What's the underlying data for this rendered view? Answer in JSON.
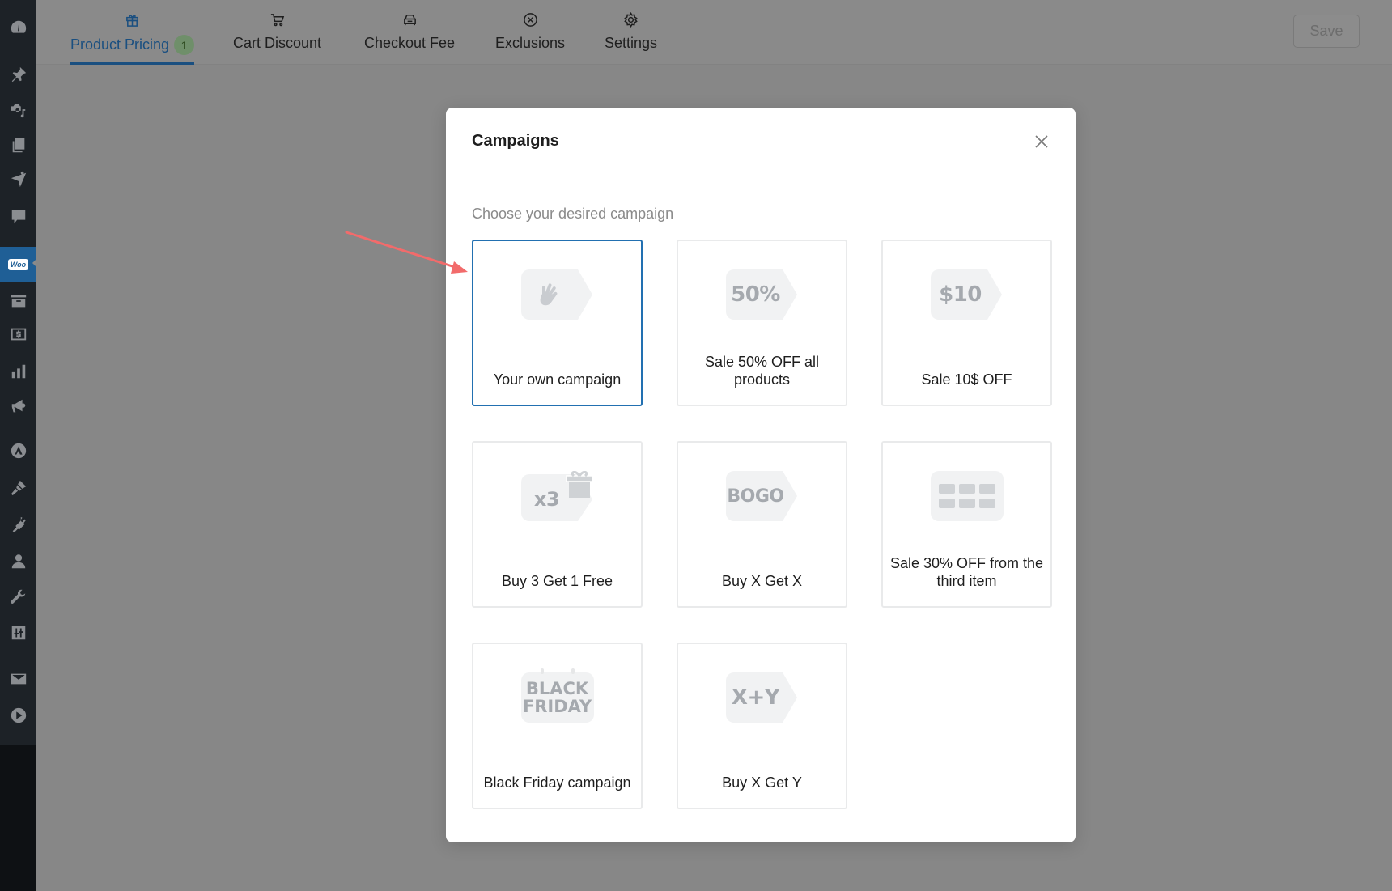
{
  "sidebar": {
    "items": [
      {
        "icon": "dashboard-icon"
      },
      {
        "icon": "pin-icon"
      },
      {
        "icon": "media-icon"
      },
      {
        "icon": "pages-icon"
      },
      {
        "icon": "send-icon"
      },
      {
        "icon": "comments-icon"
      },
      {
        "icon": "woocommerce-icon",
        "label": "Woo",
        "active": true
      },
      {
        "icon": "archive-icon"
      },
      {
        "icon": "dollar-icon"
      },
      {
        "icon": "analytics-icon"
      },
      {
        "icon": "megaphone-icon"
      },
      {
        "icon": "astra-icon"
      },
      {
        "icon": "brush-icon"
      },
      {
        "icon": "plugin-icon"
      },
      {
        "icon": "user-icon"
      },
      {
        "icon": "wrench-icon"
      },
      {
        "icon": "sliders-icon"
      },
      {
        "icon": "mail-icon"
      },
      {
        "icon": "play-icon"
      }
    ]
  },
  "tabs": [
    {
      "label": "Product Pricing",
      "icon": "gift-icon",
      "badge": "1",
      "active": true
    },
    {
      "label": "Cart Discount",
      "icon": "cart-icon"
    },
    {
      "label": "Checkout Fee",
      "icon": "car-icon"
    },
    {
      "label": "Exclusions",
      "icon": "circle-x-icon"
    },
    {
      "label": "Settings",
      "icon": "gear-icon"
    }
  ],
  "toolbar": {
    "save_label": "Save"
  },
  "modal": {
    "title": "Campaigns",
    "subtitle": "Choose your desired campaign",
    "cards": [
      {
        "label": "Your own campaign",
        "icon": "hand-icon",
        "icon_text": "",
        "selected": true
      },
      {
        "label": "Sale 50% OFF all products",
        "icon": "percent-tag-icon",
        "icon_text": "50%"
      },
      {
        "label": "Sale 10$ OFF",
        "icon": "dollar-tag-icon",
        "icon_text": "$10"
      },
      {
        "label": "Buy 3 Get 1 Free",
        "icon": "gift-tag-icon",
        "icon_text": "x3"
      },
      {
        "label": "Buy X Get X",
        "icon": "bogo-tag-icon",
        "icon_text": "BOGO"
      },
      {
        "label": "Sale 30% OFF from the third item",
        "icon": "grid-icon",
        "icon_text": ""
      },
      {
        "label": "Black Friday campaign",
        "icon": "calendar-icon",
        "icon_text_line1": "BLACK",
        "icon_text_line2": "FRIDAY"
      },
      {
        "label": "Buy X Get Y",
        "icon": "xy-tag-icon",
        "icon_text": "X+Y"
      }
    ]
  },
  "colors": {
    "accent": "#2270b1",
    "tab_active": "#1a4f80",
    "annotation_arrow": "#f26b6b",
    "sidebar_bg": "#1d2227",
    "overlay": "#878787"
  }
}
